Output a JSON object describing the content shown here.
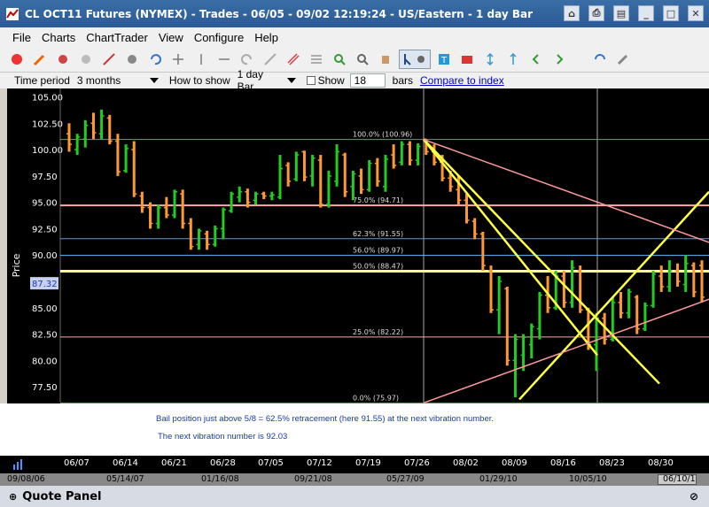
{
  "window": {
    "title": "CL OCT11 Futures (NYMEX) - Trades - 06/05 - 09/02 12:19:24 - US/Eastern - 1 day Bar"
  },
  "menu": [
    "File",
    "Charts",
    "ChartTrader",
    "View",
    "Configure",
    "Help"
  ],
  "options": {
    "time_period_label": "Time period",
    "time_period_value": "3 months",
    "how_to_show_label": "How to show",
    "how_to_show_value": "1 day Bar",
    "show_label": "Show",
    "show_value": "18",
    "bars_label": "bars",
    "compare_link": "Compare to index"
  },
  "price_labels": [
    "105.00",
    "102.50",
    "100.00",
    "97.50",
    "95.00",
    "92.50",
    "90.00",
    "87.32",
    "85.00",
    "82.50",
    "80.00",
    "77.50"
  ],
  "axis_title": "Price",
  "fib_labels": [
    "100.0% (100.96)",
    "75.0% (94.71)",
    "62.3% (91.55)",
    "56.0% (89.97)",
    "50.0% (88.47)",
    "25.0% (82.22)",
    "0.0% (75.97)"
  ],
  "annotation": {
    "line1": "Bail position just above 5/8 = 62.5% retracement (here 91.55) at the next vibration number.",
    "line2": "The next vibration number is 92.03"
  },
  "x_dates": [
    "06/07",
    "06/14",
    "06/21",
    "06/28",
    "07/05",
    "07/12",
    "07/19",
    "07/26",
    "08/02",
    "08/09",
    "08/16",
    "08/23",
    "08/30"
  ],
  "scroll_dates": [
    "09/08/06",
    "05/14/07",
    "01/16/08",
    "09/21/08",
    "05/27/09",
    "01/29/10",
    "10/05/10",
    "06/10/1"
  ],
  "quote_panel": "Quote Panel",
  "chart_data": {
    "type": "ohlc",
    "ylim": [
      76,
      106
    ],
    "ylabel": "Price",
    "bars": [
      {
        "o": 101.5,
        "h": 102.5,
        "l": 99.8,
        "c": 100.5
      },
      {
        "o": 100.0,
        "h": 101.5,
        "l": 99.5,
        "c": 101.2
      },
      {
        "o": 101.0,
        "h": 102.8,
        "l": 100.2,
        "c": 102.3
      },
      {
        "o": 102.5,
        "h": 103.5,
        "l": 101.0,
        "c": 101.6
      },
      {
        "o": 101.5,
        "h": 103.8,
        "l": 101.0,
        "c": 103.2
      },
      {
        "o": 103.0,
        "h": 103.3,
        "l": 100.5,
        "c": 100.8
      },
      {
        "o": 100.8,
        "h": 101.5,
        "l": 97.5,
        "c": 97.9
      },
      {
        "o": 98.0,
        "h": 100.5,
        "l": 97.8,
        "c": 100.1
      },
      {
        "o": 100.0,
        "h": 100.8,
        "l": 95.5,
        "c": 95.8
      },
      {
        "o": 95.6,
        "h": 96.0,
        "l": 94.0,
        "c": 94.5
      },
      {
        "o": 94.5,
        "h": 95.0,
        "l": 92.5,
        "c": 93.0
      },
      {
        "o": 93.0,
        "h": 94.8,
        "l": 92.5,
        "c": 94.5
      },
      {
        "o": 94.5,
        "h": 95.5,
        "l": 93.5,
        "c": 93.8
      },
      {
        "o": 93.8,
        "h": 96.2,
        "l": 93.5,
        "c": 96.0
      },
      {
        "o": 95.8,
        "h": 96.2,
        "l": 92.5,
        "c": 93.0
      },
      {
        "o": 93.0,
        "h": 93.5,
        "l": 90.5,
        "c": 90.8
      },
      {
        "o": 91.0,
        "h": 92.5,
        "l": 90.5,
        "c": 92.3
      },
      {
        "o": 92.0,
        "h": 92.3,
        "l": 90.5,
        "c": 91.0
      },
      {
        "o": 91.0,
        "h": 92.8,
        "l": 90.8,
        "c": 92.5
      },
      {
        "o": 92.5,
        "h": 94.5,
        "l": 91.5,
        "c": 94.3
      },
      {
        "o": 94.2,
        "h": 96.0,
        "l": 94.0,
        "c": 95.8
      },
      {
        "o": 95.5,
        "h": 96.5,
        "l": 95.0,
        "c": 96.0
      },
      {
        "o": 96.0,
        "h": 96.3,
        "l": 94.5,
        "c": 95.0
      },
      {
        "o": 95.2,
        "h": 96.0,
        "l": 94.8,
        "c": 95.8
      },
      {
        "o": 95.8,
        "h": 96.0,
        "l": 95.3,
        "c": 95.6
      },
      {
        "o": 95.6,
        "h": 96.0,
        "l": 95.2,
        "c": 95.7
      },
      {
        "o": 95.5,
        "h": 99.5,
        "l": 95.3,
        "c": 98.2
      },
      {
        "o": 98.5,
        "h": 98.8,
        "l": 96.5,
        "c": 97.0
      },
      {
        "o": 97.2,
        "h": 99.8,
        "l": 97.0,
        "c": 99.5
      },
      {
        "o": 99.8,
        "h": 99.9,
        "l": 97.0,
        "c": 97.4
      },
      {
        "o": 97.5,
        "h": 99.5,
        "l": 96.5,
        "c": 99.2
      },
      {
        "o": 99.0,
        "h": 99.5,
        "l": 94.5,
        "c": 94.8
      },
      {
        "o": 94.8,
        "h": 98.0,
        "l": 94.5,
        "c": 97.5
      },
      {
        "o": 97.0,
        "h": 100.5,
        "l": 96.5,
        "c": 99.8
      },
      {
        "o": 99.5,
        "h": 99.7,
        "l": 95.5,
        "c": 96.0
      },
      {
        "o": 96.5,
        "h": 98.0,
        "l": 95.2,
        "c": 97.7
      },
      {
        "o": 97.5,
        "h": 98.2,
        "l": 95.8,
        "c": 96.2
      },
      {
        "o": 96.2,
        "h": 99.0,
        "l": 96.0,
        "c": 98.7
      },
      {
        "o": 98.7,
        "h": 99.2,
        "l": 96.5,
        "c": 97.0
      },
      {
        "o": 96.5,
        "h": 99.5,
        "l": 96.0,
        "c": 99.1
      },
      {
        "o": 99.5,
        "h": 100.5,
        "l": 98.2,
        "c": 98.5
      },
      {
        "o": 98.8,
        "h": 100.8,
        "l": 98.5,
        "c": 100.5
      },
      {
        "o": 100.5,
        "h": 100.8,
        "l": 98.5,
        "c": 99.0
      },
      {
        "o": 99.0,
        "h": 100.6,
        "l": 98.5,
        "c": 100.3
      },
      {
        "o": 101.0,
        "h": 101.0,
        "l": 99.5,
        "c": 99.8
      },
      {
        "o": 99.8,
        "h": 100.5,
        "l": 98.5,
        "c": 98.8
      },
      {
        "o": 98.8,
        "h": 99.5,
        "l": 97.0,
        "c": 97.3
      },
      {
        "o": 97.3,
        "h": 98.0,
        "l": 96.0,
        "c": 96.5
      },
      {
        "o": 96.2,
        "h": 97.5,
        "l": 94.8,
        "c": 95.2
      },
      {
        "o": 95.2,
        "h": 95.8,
        "l": 93.0,
        "c": 93.3
      },
      {
        "o": 93.2,
        "h": 93.5,
        "l": 91.5,
        "c": 92.0
      },
      {
        "o": 92.0,
        "h": 92.2,
        "l": 88.5,
        "c": 89.0
      },
      {
        "o": 88.5,
        "h": 89.0,
        "l": 84.5,
        "c": 84.8
      },
      {
        "o": 84.8,
        "h": 88.0,
        "l": 82.5,
        "c": 87.5
      },
      {
        "o": 86.8,
        "h": 87.0,
        "l": 79.5,
        "c": 80.0
      },
      {
        "o": 80.0,
        "h": 82.5,
        "l": 76.5,
        "c": 82.0
      },
      {
        "o": 80.5,
        "h": 82.5,
        "l": 79.0,
        "c": 82.2
      },
      {
        "o": 81.5,
        "h": 83.5,
        "l": 80.2,
        "c": 83.2
      },
      {
        "o": 83.0,
        "h": 86.5,
        "l": 82.0,
        "c": 86.2
      },
      {
        "o": 86.2,
        "h": 88.0,
        "l": 84.5,
        "c": 85.0
      },
      {
        "o": 85.0,
        "h": 88.5,
        "l": 84.8,
        "c": 88.0
      },
      {
        "o": 88.0,
        "h": 88.5,
        "l": 85.0,
        "c": 85.5
      },
      {
        "o": 85.5,
        "h": 89.5,
        "l": 85.0,
        "c": 88.8
      },
      {
        "o": 88.5,
        "h": 89.0,
        "l": 84.5,
        "c": 84.8
      },
      {
        "o": 84.8,
        "h": 85.0,
        "l": 81.0,
        "c": 81.5
      },
      {
        "o": 81.5,
        "h": 84.5,
        "l": 79.0,
        "c": 84.0
      },
      {
        "o": 84.0,
        "h": 84.5,
        "l": 81.5,
        "c": 82.0
      },
      {
        "o": 82.0,
        "h": 86.0,
        "l": 81.8,
        "c": 85.5
      },
      {
        "o": 85.5,
        "h": 86.5,
        "l": 84.0,
        "c": 84.5
      },
      {
        "o": 84.5,
        "h": 86.8,
        "l": 84.0,
        "c": 86.5
      },
      {
        "o": 86.0,
        "h": 86.2,
        "l": 82.5,
        "c": 83.0
      },
      {
        "o": 83.0,
        "h": 85.5,
        "l": 82.8,
        "c": 85.2
      },
      {
        "o": 85.2,
        "h": 88.5,
        "l": 85.0,
        "c": 88.2
      },
      {
        "o": 88.0,
        "h": 89.0,
        "l": 86.5,
        "c": 87.0
      },
      {
        "o": 87.0,
        "h": 89.5,
        "l": 86.5,
        "c": 88.5
      },
      {
        "o": 88.5,
        "h": 89.2,
        "l": 87.0,
        "c": 87.5
      },
      {
        "o": 87.2,
        "h": 90.0,
        "l": 86.5,
        "c": 89.2
      },
      {
        "o": 89.0,
        "h": 89.3,
        "l": 86.0,
        "c": 86.5
      },
      {
        "o": 89.0,
        "h": 89.5,
        "l": 85.5,
        "c": 86.0
      }
    ],
    "fib_levels": [
      100.96,
      94.71,
      91.55,
      89.97,
      88.47,
      82.22,
      75.97
    ],
    "fib_colors": [
      "#66aa44",
      "#ffaaaa",
      "#6699cc",
      "#66bbff",
      "#ffff88",
      "#ffaaaa",
      "#66aa44"
    ],
    "colors": {
      "up": "#22cc22",
      "down": "#ff9933",
      "fan": "#ffff44",
      "trend": "#ff9999"
    }
  }
}
